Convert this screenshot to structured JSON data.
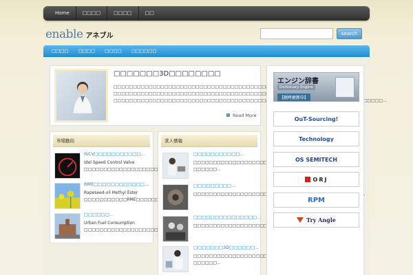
{
  "header": {
    "nav": [
      "Home",
      "□□□□",
      "□□□□",
      "□□"
    ],
    "logo_en": "enable",
    "logo_jp": "アネブル",
    "search_placeholder": "",
    "search_label": "search"
  },
  "subnav": [
    "□□□□",
    "□□□□",
    "□□□□",
    "□□□□□□"
  ],
  "feature": {
    "title": "□□□□□□□3D□□□□□□□□",
    "body": "□□□□□□□□□□□□□□□□□□□□□□□□□□□□□□□□□□□□□□□□□□ □□□□□□□□□□□□□□□□□□□□□□□□□□□□□□□□□□□□□□□□□□□□□□□□□□□□ □□□□□□□□□□□□□□□□□□□□□□□□□□□□□□□□□□□□□□□□□□□□□□□□□□□□□□□□□□□□□□□□□□□□□...",
    "read_more": "Read More"
  },
  "market": {
    "header": "市場動向",
    "items": [
      {
        "title": "ISCV□□□□□□□□□□□...",
        "text": "Idel Speed Control Valve □□□□□□□□□□□□□□□□□□□□□..."
      },
      {
        "title": "RME□□□□□□□□□□□□...",
        "text": "Rapeseed-oil Methyl Ester □□□□□□□□□□□RME□□□□□□□□..."
      },
      {
        "title": "□□□□□□...",
        "text": "Urban Fuel Consumption □□□□□□□□□□□□□□□□□□□□□□□□..."
      }
    ]
  },
  "jobs": {
    "header": "求人情報",
    "items": [
      {
        "title": "□□□□□□□□□□□...",
        "text": "□□□□□□□□□□□□□□□□□□□□□□□□□□□□□□□□□ □□□□□□..."
      },
      {
        "title": "□□□□□□□□□...",
        "text": "□□□□□□□□□□□□□□□□□□□□□□□□□□□□□□□□□□□□□□□□□□□..."
      },
      {
        "title": "□□□□□□□□□□□□□□□...",
        "text": "□□□□□□□□□□□□□□□□□□□□□□□□□□□□□□□□□□□□□□□□..."
      },
      {
        "title": "□□□□□□□3D□□□□□□...",
        "text": "□□□□□□□□□□□□□□□□□□□□□□□□□□□□□ □□□□□□..."
      }
    ]
  },
  "sidebar": {
    "dict": {
      "title": "エンジン辞書",
      "sub": "Dictionary Engine",
      "note": "【随時更新中】"
    },
    "banners": [
      {
        "label": "OuT-Sourcing!",
        "color": "#1d4ea0"
      },
      {
        "label": "Technology",
        "color": "#1d4ea0"
      },
      {
        "label": "OS SEMITECH",
        "color": "#1b3f8a"
      },
      {
        "label": "ORJ",
        "color": "#222"
      },
      {
        "label": "RPM",
        "color": "#2c6fc2"
      },
      {
        "label": "Try Angle",
        "color": "#2a2a60"
      }
    ]
  }
}
